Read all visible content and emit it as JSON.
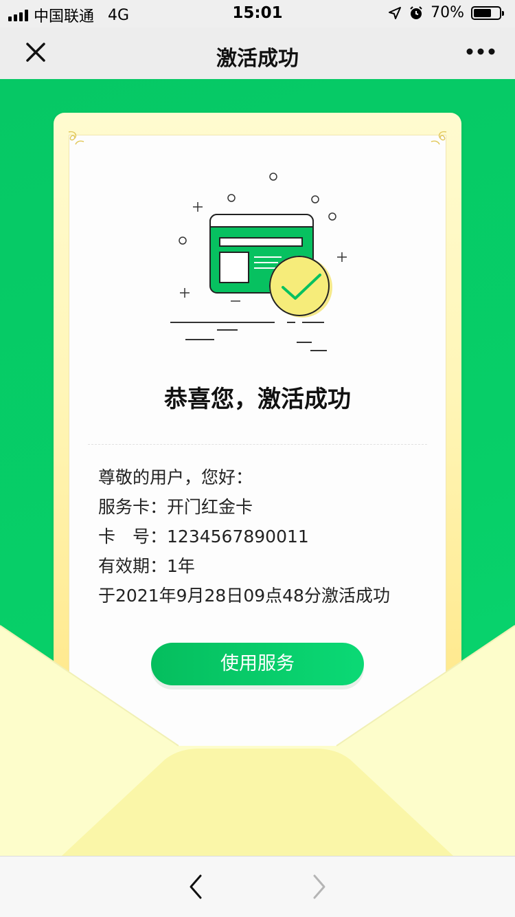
{
  "status_bar": {
    "carrier": "中国联通",
    "network": "4G",
    "time": "15:01",
    "battery_percent": "70%",
    "battery_level": 0.7
  },
  "nav": {
    "title": "激活成功",
    "close_icon": "close-icon",
    "more_icon": "more-icon"
  },
  "card": {
    "headline": "恭喜您，激活成功",
    "greeting": "尊敬的用户，您好：",
    "service_label": "服务卡：",
    "service_value": "开门红金卡",
    "number_label": "卡　号：",
    "number_value": "1234567890011",
    "validity_label": "有效期：",
    "validity_value": "1年",
    "activation_text": "于2021年9月28日09点48分激活成功",
    "button_label": "使用服务"
  },
  "colors": {
    "brand_green": "#07c160",
    "check_yellow": "#f6ec7a",
    "card_gold": "#ffe47d",
    "envelope_yellow": "#fdfcc8"
  },
  "bottom_bar": {
    "back_icon": "chevron-left-icon",
    "forward_icon": "chevron-right-icon"
  }
}
